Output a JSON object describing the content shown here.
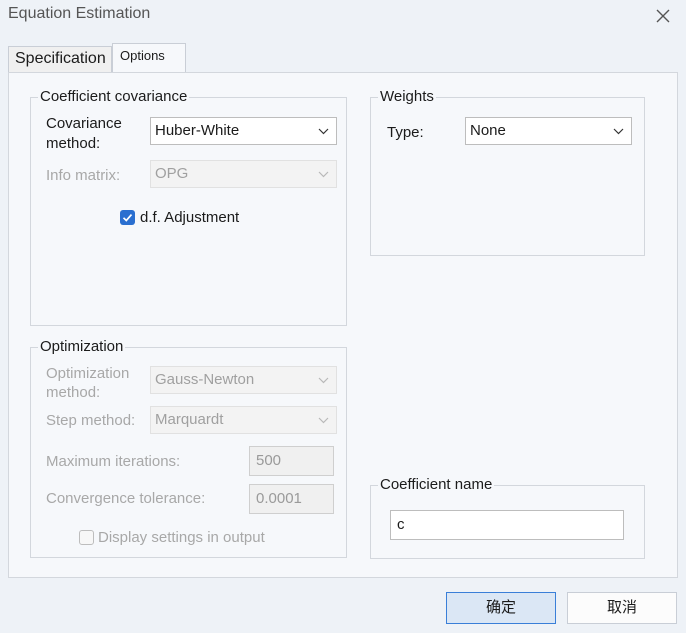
{
  "window": {
    "title": "Equation Estimation"
  },
  "tabs": [
    {
      "label": "Specification",
      "active": false
    },
    {
      "label": "Options",
      "active": true
    }
  ],
  "coefficient_covariance": {
    "title": "Coefficient covariance",
    "covariance_method_label_line1": "Covariance",
    "covariance_method_label_line2": "method:",
    "covariance_method_value": "Huber-White",
    "info_matrix_label": "Info matrix:",
    "info_matrix_value": "OPG",
    "df_adjustment_label": "d.f. Adjustment",
    "df_adjustment_checked": true
  },
  "weights": {
    "title": "Weights",
    "type_label": "Type:",
    "type_value": "None"
  },
  "optimization": {
    "title": "Optimization",
    "method_label_line1": "Optimization",
    "method_label_line2": "method:",
    "method_value": "Gauss-Newton",
    "step_method_label": "Step method:",
    "step_method_value": "Marquardt",
    "max_iterations_label": "Maximum iterations:",
    "max_iterations_value": "500",
    "convergence_label": "Convergence tolerance:",
    "convergence_value": "0.0001",
    "display_settings_label": "Display settings in output",
    "display_settings_checked": false
  },
  "coefficient_name": {
    "title": "Coefficient name",
    "value": "c"
  },
  "buttons": {
    "ok": "确定",
    "cancel": "取消"
  },
  "colors": {
    "accent": "#2a6fd0",
    "ok_border": "#3a7fd8",
    "ok_background": "#dbe7f5"
  }
}
